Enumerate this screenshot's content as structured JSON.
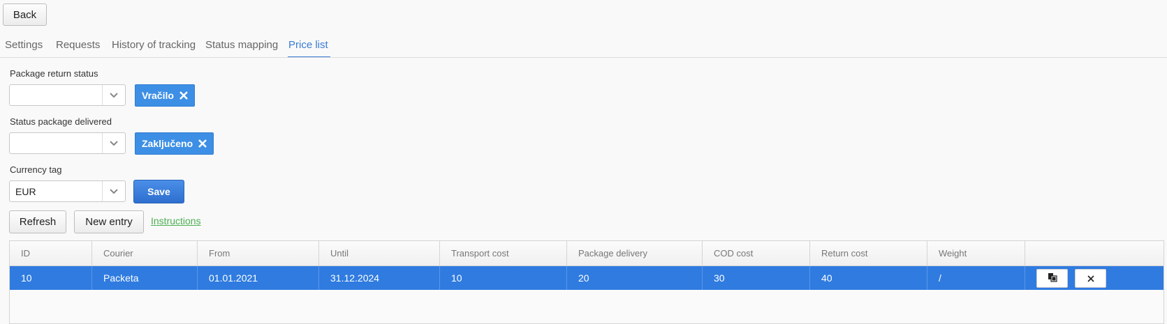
{
  "toolbar": {
    "back_label": "Back"
  },
  "tabs": [
    {
      "label": "Settings"
    },
    {
      "label": "Requests"
    },
    {
      "label": "History of tracking"
    },
    {
      "label": "Status mapping"
    },
    {
      "label": "Price list",
      "active": true
    }
  ],
  "form": {
    "return_status": {
      "label": "Package return status",
      "value": "",
      "tag": "Vračilo"
    },
    "delivered_status": {
      "label": "Status package delivered",
      "value": "",
      "tag": "Zaključeno"
    },
    "currency": {
      "label": "Currency tag",
      "value": "EUR"
    },
    "save_label": "Save"
  },
  "actions": {
    "refresh_label": "Refresh",
    "new_entry_label": "New entry",
    "instructions_label": "Instructions"
  },
  "table": {
    "columns": [
      "ID",
      "Courier",
      "From",
      "Until",
      "Transport cost",
      "Package delivery",
      "COD cost",
      "Return cost",
      "Weight"
    ],
    "rows": [
      {
        "cells": [
          "10",
          "Packeta",
          "01.01.2021",
          "31.12.2024",
          "10",
          "20",
          "30",
          "40",
          "/"
        ],
        "selected": true
      }
    ]
  },
  "colors": {
    "accent": "#3d8fe5",
    "selected_row": "#2f7be0",
    "link": "#4caf50"
  },
  "icons": {
    "copy": "copy-icon",
    "delete": "close-icon",
    "dropdown": "chevron-down-icon",
    "remove_tag": "close-icon"
  }
}
